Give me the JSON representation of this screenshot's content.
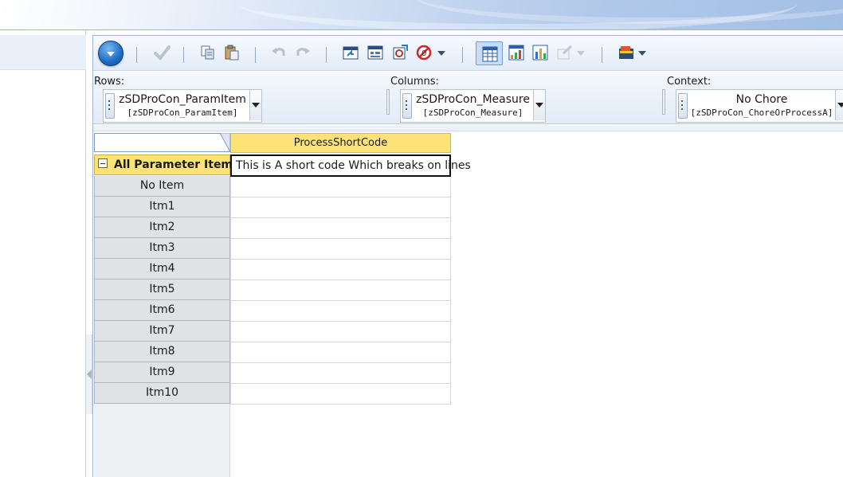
{
  "toolbar": {
    "icons": [
      "menu-orb",
      "commit-icon",
      "copy-icon",
      "paste-icon",
      "undo-icon",
      "redo-icon",
      "sandbox-icon",
      "calc-icon",
      "link-icon",
      "zero-suppress-icon",
      "grid-view-icon",
      "grid-chart-icon",
      "chart-icon",
      "export-icon",
      "subset-icon"
    ]
  },
  "dimensions": {
    "rows": {
      "label": "Rows:",
      "name": "zSDProCon_ParamItem",
      "sub": "[zSDProCon_ParamItem]"
    },
    "columns": {
      "label": "Columns:",
      "name": "zSDProCon_Measure",
      "sub": "[zSDProCon_Measure]"
    },
    "context": {
      "label": "Context:",
      "name": "No Chore",
      "sub": "[zSDProCon_ChoreOrProcessA]"
    }
  },
  "grid": {
    "column_header": "ProcessShortCode",
    "root_row": "All Parameter Items",
    "root_value": "This is A short code Which breaks on lines",
    "rows": [
      "No Item",
      "Itm1",
      "Itm2",
      "Itm3",
      "Itm4",
      "Itm5",
      "Itm6",
      "Itm7",
      "Itm8",
      "Itm9",
      "Itm10"
    ]
  },
  "colors": {
    "header_yellow": "#fde377",
    "row_header_gray": "#e0e2e5",
    "toolbar_blue": "#e3ecf8"
  }
}
